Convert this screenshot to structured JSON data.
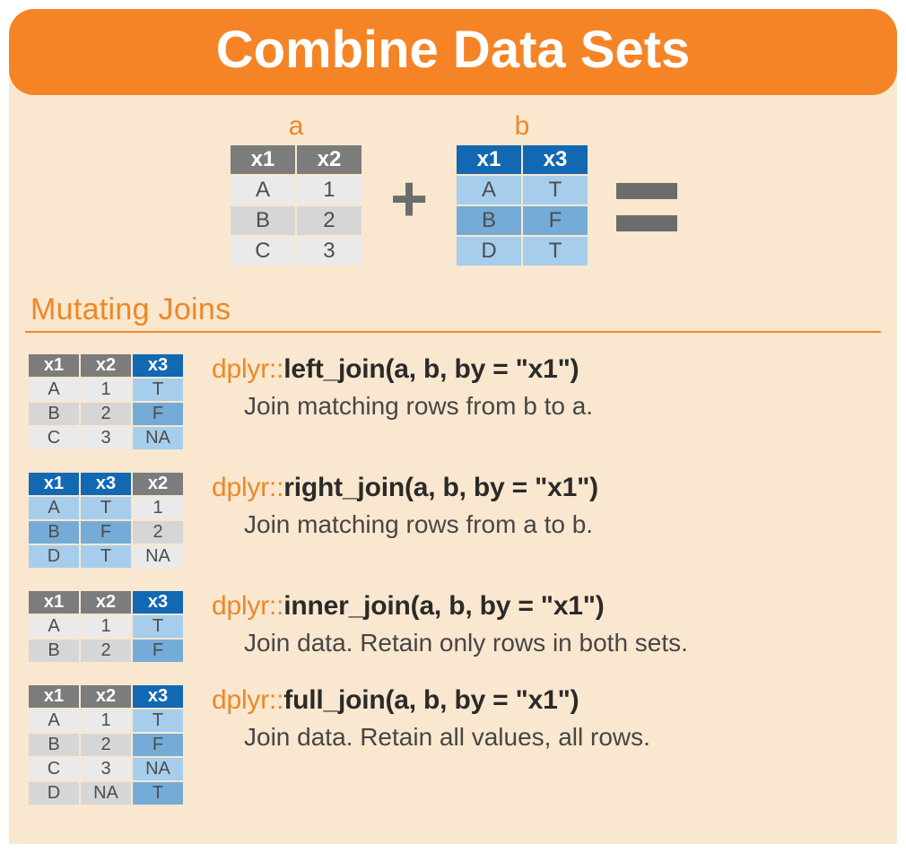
{
  "title": "Combine Data Sets",
  "tables": {
    "a": {
      "label": "a",
      "headers": [
        "x1",
        "x2"
      ],
      "rows": [
        [
          "A",
          "1"
        ],
        [
          "B",
          "2"
        ],
        [
          "C",
          "3"
        ]
      ]
    },
    "b": {
      "label": "b",
      "headers": [
        "x1",
        "x3"
      ],
      "rows": [
        [
          "A",
          "T"
        ],
        [
          "B",
          "F"
        ],
        [
          "D",
          "T"
        ]
      ]
    }
  },
  "section": "Mutating Joins",
  "joins": [
    {
      "pkg": "dplyr::",
      "fn": "left_join",
      "args": "(a, b, by = \"x1\")",
      "desc": "Join matching rows from b to a.",
      "headers": [
        {
          "t": "x1",
          "c": "g"
        },
        {
          "t": "x2",
          "c": "g"
        },
        {
          "t": "x3",
          "c": "b"
        }
      ],
      "rows": [
        [
          {
            "t": "A",
            "c": "g"
          },
          {
            "t": "1",
            "c": "g"
          },
          {
            "t": "T",
            "c": "b"
          }
        ],
        [
          {
            "t": "B",
            "c": "g"
          },
          {
            "t": "2",
            "c": "g"
          },
          {
            "t": "F",
            "c": "b"
          }
        ],
        [
          {
            "t": "C",
            "c": "g"
          },
          {
            "t": "3",
            "c": "g"
          },
          {
            "t": "NA",
            "c": "b",
            "na": true
          }
        ]
      ]
    },
    {
      "pkg": "dplyr::",
      "fn": "right_join",
      "args": "(a, b, by = \"x1\")",
      "desc": "Join matching rows from a to b.",
      "headers": [
        {
          "t": "x1",
          "c": "b"
        },
        {
          "t": "x3",
          "c": "b"
        },
        {
          "t": "x2",
          "c": "g"
        }
      ],
      "rows": [
        [
          {
            "t": "A",
            "c": "b"
          },
          {
            "t": "T",
            "c": "b"
          },
          {
            "t": "1",
            "c": "g"
          }
        ],
        [
          {
            "t": "B",
            "c": "b"
          },
          {
            "t": "F",
            "c": "b"
          },
          {
            "t": "2",
            "c": "g"
          }
        ],
        [
          {
            "t": "D",
            "c": "b"
          },
          {
            "t": "T",
            "c": "b"
          },
          {
            "t": "NA",
            "c": "g",
            "na": true
          }
        ]
      ]
    },
    {
      "pkg": "dplyr::",
      "fn": "inner_join",
      "args": "(a, b, by = \"x1\")",
      "desc": "Join data. Retain only rows in both sets.",
      "headers": [
        {
          "t": "x1",
          "c": "g"
        },
        {
          "t": "x2",
          "c": "g"
        },
        {
          "t": "x3",
          "c": "b"
        }
      ],
      "rows": [
        [
          {
            "t": "A",
            "c": "g"
          },
          {
            "t": "1",
            "c": "g"
          },
          {
            "t": "T",
            "c": "b"
          }
        ],
        [
          {
            "t": "B",
            "c": "g"
          },
          {
            "t": "2",
            "c": "g"
          },
          {
            "t": "F",
            "c": "b"
          }
        ]
      ]
    },
    {
      "pkg": "dplyr::",
      "fn": "full_join",
      "args": "(a, b, by = \"x1\")",
      "desc": "Join data. Retain all values, all rows.",
      "headers": [
        {
          "t": "x1",
          "c": "g"
        },
        {
          "t": "x2",
          "c": "g"
        },
        {
          "t": "x3",
          "c": "b"
        }
      ],
      "rows": [
        [
          {
            "t": "A",
            "c": "g"
          },
          {
            "t": "1",
            "c": "g"
          },
          {
            "t": "T",
            "c": "b"
          }
        ],
        [
          {
            "t": "B",
            "c": "g"
          },
          {
            "t": "2",
            "c": "g"
          },
          {
            "t": "F",
            "c": "b"
          }
        ],
        [
          {
            "t": "C",
            "c": "g"
          },
          {
            "t": "3",
            "c": "g"
          },
          {
            "t": "NA",
            "c": "b",
            "na": true
          }
        ],
        [
          {
            "t": "D",
            "c": "g"
          },
          {
            "t": "NA",
            "c": "g",
            "na": true
          },
          {
            "t": "T",
            "c": "b"
          }
        ]
      ]
    }
  ]
}
